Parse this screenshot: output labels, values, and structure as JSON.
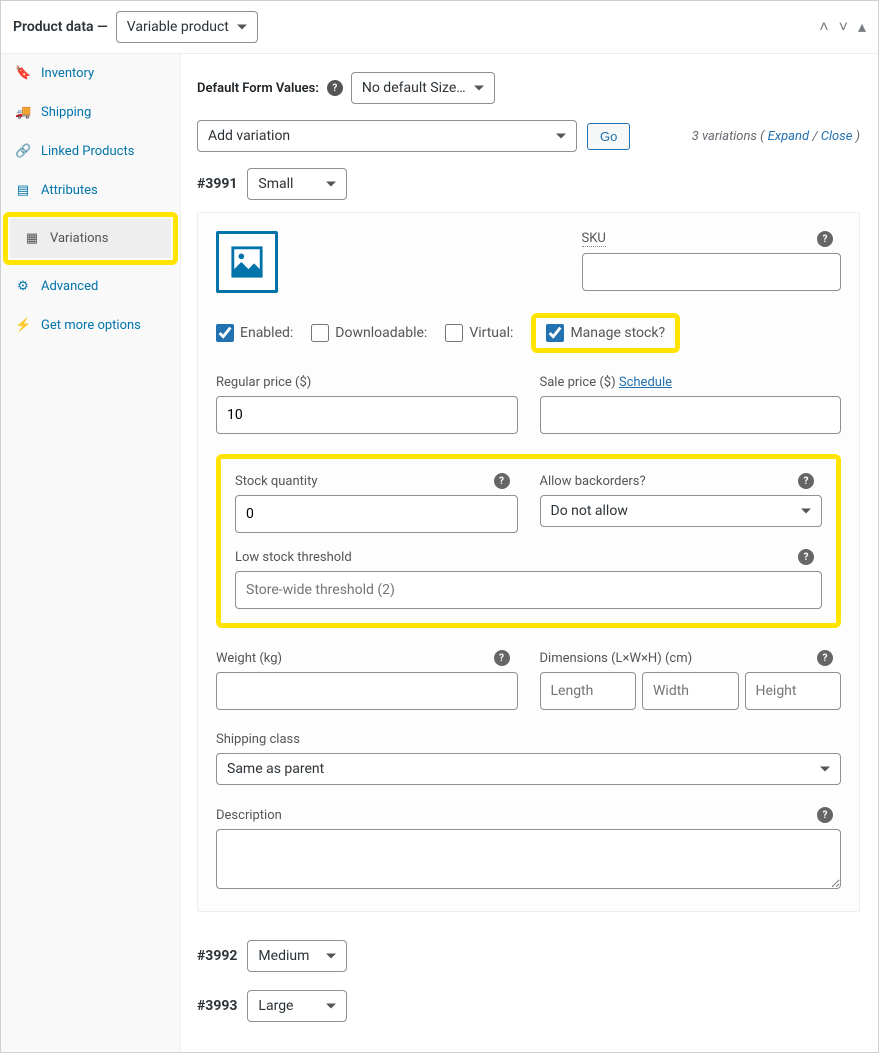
{
  "header": {
    "title": "Product data —",
    "product_type": "Variable product"
  },
  "sidebar": {
    "items": [
      {
        "label": "Inventory",
        "icon": "📋"
      },
      {
        "label": "Shipping",
        "icon": "🚚"
      },
      {
        "label": "Linked Products",
        "icon": "🔗"
      },
      {
        "label": "Attributes",
        "icon": "📇"
      },
      {
        "label": "Variations",
        "icon": "▦"
      },
      {
        "label": "Advanced",
        "icon": "⚙"
      },
      {
        "label": "Get more options",
        "icon": "⚡"
      }
    ]
  },
  "defaults": {
    "label": "Default Form Values:",
    "value": "No default Size…"
  },
  "add_variation": {
    "label": "Add variation",
    "go": "Go"
  },
  "variations_meta": {
    "count": "3 variations",
    "open_paren": " (",
    "expand": "Expand",
    "slash": " / ",
    "close": "Close",
    "close_paren": ")"
  },
  "variation": {
    "id": "#3991",
    "size": "Small",
    "sku_label": "SKU",
    "enabled": "Enabled:",
    "downloadable": "Downloadable:",
    "virtual": "Virtual:",
    "manage_stock": "Manage stock?",
    "regular_price_label": "Regular price ($)",
    "regular_price": "10",
    "sale_price_label": "Sale price ($)",
    "schedule": "Schedule",
    "stock_qty_label": "Stock quantity",
    "stock_qty": "0",
    "backorders_label": "Allow backorders?",
    "backorders_value": "Do not allow",
    "low_stock_label": "Low stock threshold",
    "low_stock_placeholder": "Store-wide threshold (2)",
    "weight_label": "Weight (kg)",
    "dimensions_label": "Dimensions (L×W×H) (cm)",
    "dim_length_ph": "Length",
    "dim_width_ph": "Width",
    "dim_height_ph": "Height",
    "shipping_class_label": "Shipping class",
    "shipping_class_value": "Same as parent",
    "description_label": "Description"
  },
  "other_variations": [
    {
      "id": "#3992",
      "size": "Medium"
    },
    {
      "id": "#3993",
      "size": "Large"
    }
  ]
}
